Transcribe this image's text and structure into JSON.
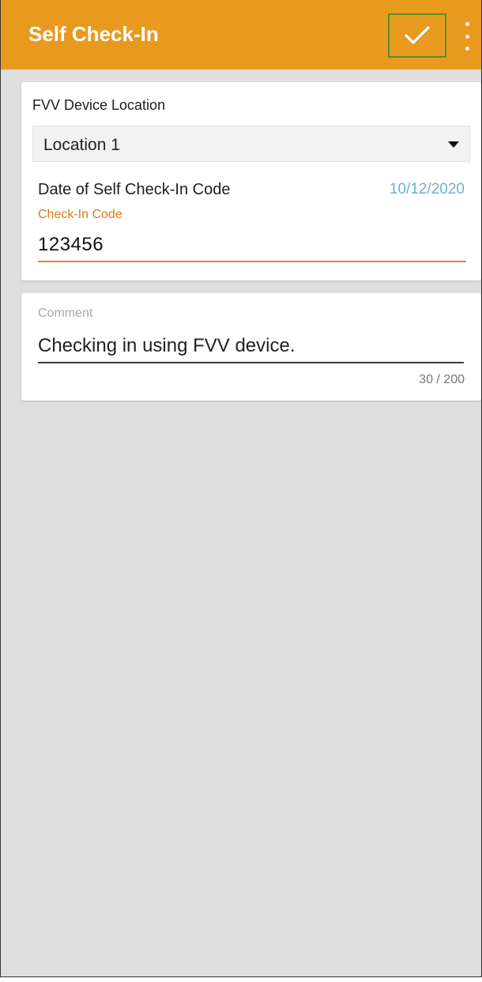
{
  "appbar": {
    "title": "Self Check-In",
    "confirm_icon": "check-icon",
    "overflow_icon": "more-vert-icon",
    "color": "#e89a1f"
  },
  "location": {
    "label": "FVV Device Location",
    "selected": "Location 1"
  },
  "date": {
    "label": "Date of Self Check-In Code",
    "value": "10/12/2020"
  },
  "checkin_code": {
    "label": "Check-In Code",
    "value": "123456"
  },
  "comment": {
    "label": "Comment",
    "value": "Checking in using FVV device.",
    "counter": "30 / 200"
  }
}
